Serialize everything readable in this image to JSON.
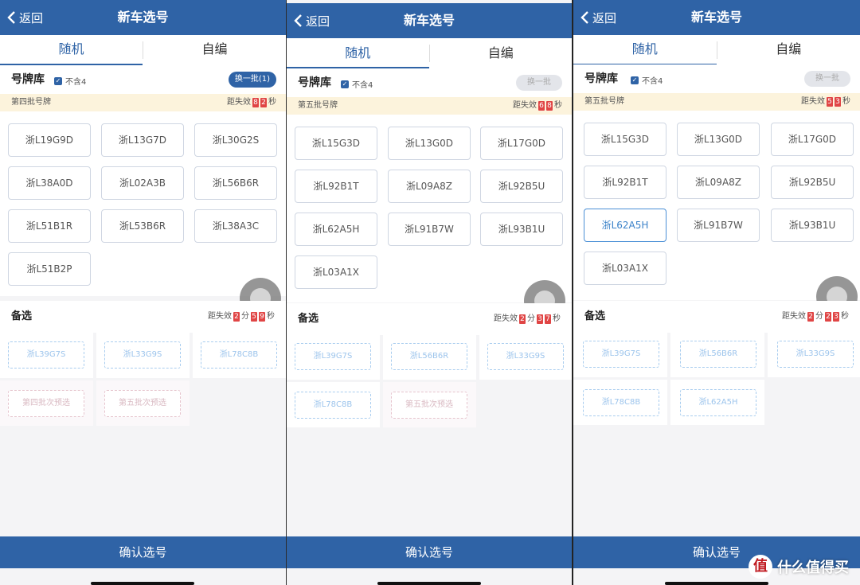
{
  "common": {
    "back_label": "返回",
    "title": "新车选号",
    "tab_random": "随机",
    "tab_custom": "自编",
    "library_label": "号牌库",
    "exclude_four": "不含4",
    "expire_label": "距失效",
    "reserve_label": "备选",
    "minute_unit": "分",
    "second_unit": "秒",
    "confirm_label": "确认选号"
  },
  "screen1": {
    "swap_label": "换一批(1)",
    "batch_label": "第四批号牌",
    "countdown": [
      "8",
      "2"
    ],
    "plates": [
      "浙L19G9D",
      "浙L13G7D",
      "浙L30G2S",
      "浙L38A0D",
      "浙L02A3B",
      "浙L56B6R",
      "浙L51B1R",
      "浙L53B6R",
      "浙L38A3C",
      "浙L51B2P"
    ],
    "reserve_min": "2",
    "reserve_sec": [
      "5",
      "9"
    ],
    "reserve": [
      "浙L39G7S",
      "浙L33G9S",
      "浙L78C8B",
      "第四批次预选",
      "第五批次预选"
    ]
  },
  "screen2": {
    "swap_label": "换一批",
    "batch_label": "第五批号牌",
    "countdown": [
      "6",
      "8"
    ],
    "plates": [
      "浙L15G3D",
      "浙L13G0D",
      "浙L17G0D",
      "浙L92B1T",
      "浙L09A8Z",
      "浙L92B5U",
      "浙L62A5H",
      "浙L91B7W",
      "浙L93B1U",
      "浙L03A1X"
    ],
    "reserve_min": "2",
    "reserve_sec": [
      "3",
      "7"
    ],
    "reserve": [
      "浙L39G7S",
      "浙L56B6R",
      "浙L33G9S",
      "浙L78C8B",
      "第五批次预选"
    ]
  },
  "screen3": {
    "swap_label": "换一批",
    "batch_label": "第五批号牌",
    "countdown": [
      "5",
      "3"
    ],
    "plates": [
      "浙L15G3D",
      "浙L13G0D",
      "浙L17G0D",
      "浙L92B1T",
      "浙L09A8Z",
      "浙L92B5U",
      "浙L62A5H",
      "浙L91B7W",
      "浙L93B1U",
      "浙L03A1X"
    ],
    "reserve_min": "2",
    "reserve_sec": [
      "2",
      "3"
    ],
    "reserve": [
      "浙L39G7S",
      "浙L56B6R",
      "浙L33G9S",
      "浙L78C8B",
      "浙L62A5H"
    ]
  },
  "watermark": {
    "logo": "值",
    "text": "什么值得买"
  },
  "colors": {
    "brand_blue": "#2f63a6",
    "countdown_red": "#e04545",
    "batch_bg": "#fcf3dc"
  }
}
